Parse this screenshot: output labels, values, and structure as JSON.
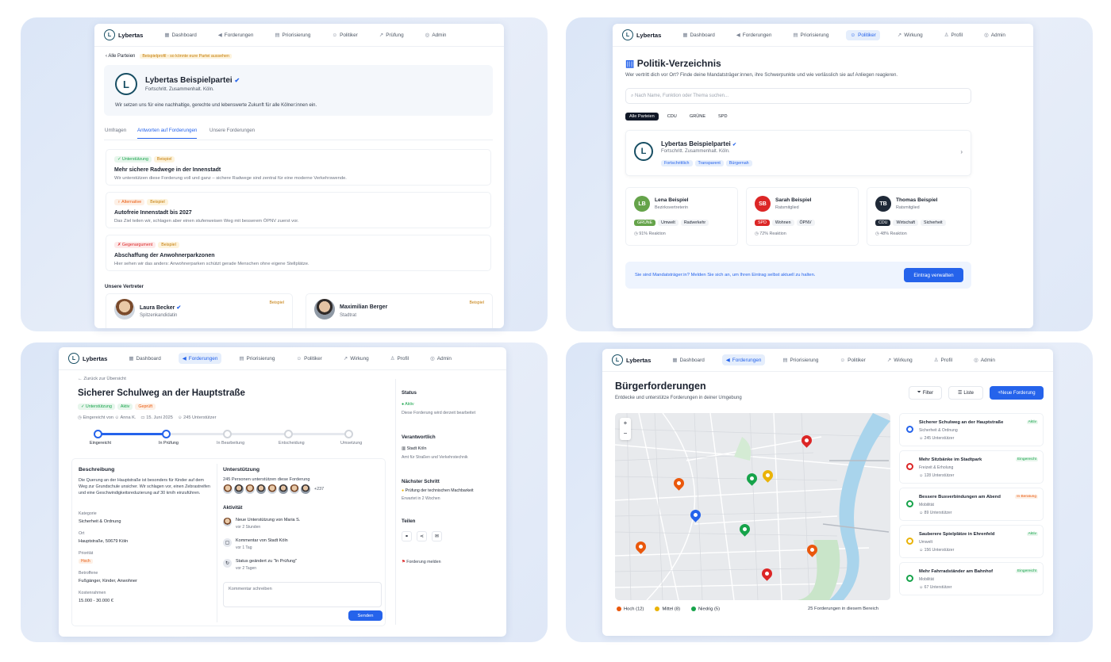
{
  "nav": {
    "logo": "Lybertas",
    "dashboard": "Dashboard",
    "forderungen": "Forderungen",
    "priorisierung": "Priorisierung",
    "politiker": "Politiker",
    "pruefung": "Prüfung",
    "admin": "Admin",
    "wirkung": "Wirkung",
    "profil": "Profil"
  },
  "party": {
    "back": "Alle Parteien",
    "banner": "Beispielprofil - so könnte eure Partei aussehen",
    "name": "Lybertas Beispielpartei",
    "slogan": "Fortschritt. Zusammenhalt. Köln.",
    "desc": "Wir setzen uns für eine nachhaltige, gerechte und lebenswerte Zukunft für alle Kölner:innen ein.",
    "tabs": [
      "Umfragen",
      "Antworten auf Forderungen",
      "Unsere Forderungen"
    ],
    "answers": [
      {
        "tag": "Unterstützung",
        "badge": "Beispiel",
        "title": "Mehr sichere Radwege in der Innenstadt",
        "text": "Wir unterstützen diese Forderung voll und ganz – sichere Radwege sind zentral für eine moderne Verkehrswende.",
        "color": "#16a34a",
        "bg": "#e7f6ec"
      },
      {
        "tag": "Alternative",
        "badge": "Beispiel",
        "title": "Autofreie Innenstadt bis 2027",
        "text": "Das Ziel teilen wir, schlagen aber einen stufenweisen Weg mit besserem ÖPNV zuerst vor.",
        "color": "#ea580c",
        "bg": "#fdf0e6"
      },
      {
        "tag": "Gegenargument",
        "badge": "Beispiel",
        "title": "Abschaffung der Anwohnerparkzonen",
        "text": "Hier sehen wir das anders: Anwohnerparken schützt gerade Menschen ohne eigene Stellplätze.",
        "color": "#dc2626",
        "bg": "#fdeaea"
      }
    ],
    "reps_title": "Unsere Vertreter",
    "reps": [
      {
        "name": "Laura Becker",
        "role": "Spitzenkandidatin",
        "badge": "Beispiel"
      },
      {
        "name": "Maximilian Berger",
        "role": "Stadtrat",
        "badge": "Beispiel"
      }
    ]
  },
  "politik": {
    "title": "Politik-Verzeichnis",
    "subtitle": "Wer vertritt dich vor Ort? Finde deine Mandatsträger:innen, ihre Schwerpunkte und wie verlässlich sie auf Anliegen reagieren.",
    "search_placeholder": "Nach Name, Funktion oder Thema suchen...",
    "filters": [
      "Alle Parteien",
      "CDU",
      "GRÜNE",
      "SPD"
    ],
    "party": {
      "name": "Lybertas Beispielpartei",
      "slogan": "Fortschritt. Zusammenhalt. Köln.",
      "tags": [
        "Fortschrittlich",
        "Transparent",
        "Bürgernah"
      ]
    },
    "people": [
      {
        "initials": "LB",
        "name": "Lena Beispiel",
        "role": "Bezirksvertreterin",
        "party": "GRÜNE",
        "tags": [
          "Umwelt",
          "Radverkehr"
        ],
        "reaction": "91% Reaktion",
        "color": "#65a34a"
      },
      {
        "initials": "SB",
        "name": "Sarah Beispiel",
        "role": "Ratsmitglied",
        "party": "SPD",
        "tags": [
          "Wohnen",
          "ÖPNV"
        ],
        "reaction": "72% Reaktion",
        "color": "#dc2626"
      },
      {
        "initials": "TB",
        "name": "Thomas Beispiel",
        "role": "Ratsmitglied",
        "party": "CDU",
        "tags": [
          "Wirtschaft",
          "Sicherheit"
        ],
        "reaction": "48% Reaktion",
        "color": "#1f2937"
      }
    ],
    "cta_text": "Sie sind Mandatsträger:in? Melden Sie sich an, um Ihren Eintrag selbst aktuell zu halten.",
    "cta_button": "Eintrag verwalten"
  },
  "detail": {
    "back": "Zurück zur Übersicht",
    "title": "Sicherer Schulweg an der Hauptstraße",
    "chips": [
      "Unterstützung",
      "Aktiv",
      "Geprüft"
    ],
    "submitted_by": "Eingereicht von",
    "author": "Anna K.",
    "date": "15. Juni 2025",
    "supporters": "245 Unterstützer",
    "steps": [
      "Eingereicht",
      "In Prüfung",
      "In Bearbeitung",
      "Entscheidung",
      "Umsetzung"
    ],
    "desc_title": "Beschreibung",
    "desc": "Die Querung an der Hauptstraße ist besonders für Kinder auf dem Weg zur Grundschule unsicher. Wir schlagen vor, einen Zebrastreifen und eine Geschwindigkeitsreduzierung auf 30 km/h einzuführen.",
    "kategorie_label": "Kategorie",
    "kategorie": "Sicherheit & Ordnung",
    "ort_label": "Ort",
    "ort": "Hauptstraße, 50679 Köln",
    "prio_label": "Priorität",
    "prio": "Hoch",
    "betroffene_label": "Betroffene",
    "betroffene": "Fußgänger, Kinder, Anwohner",
    "kosten_label": "Kostenrahmen",
    "kosten": "15.000 - 30.000 €",
    "support_title": "Unterstützung",
    "support_text": "245 Personen unterstützen diese Forderung",
    "more": "+237",
    "activity_title": "Aktivität",
    "activities": [
      {
        "text": "Neue Unterstützung von Maria S.",
        "time": "vor 2 Stunden"
      },
      {
        "text": "Kommentar von Stadt Köln",
        "time": "vor 1 Tag"
      },
      {
        "text": "Status geändert zu \"In Prüfung\"",
        "time": "vor 2 Tagen"
      }
    ],
    "comment_placeholder": "Kommentar schreiben",
    "send": "Senden",
    "status_title": "Status",
    "status": "Aktiv",
    "status_text": "Diese Forderung wird derzeit bearbeitet",
    "resp_title": "Verantwortlich",
    "resp_org": "Stadt Köln",
    "resp_dept": "Amt für Straßen und Verkehrstechnik",
    "next_title": "Nächster Schritt",
    "next": "Prüfung der technischen Machbarkeit",
    "next_eta": "Erwartet in 2 Wochen",
    "share_title": "Teilen",
    "report": "Forderung melden"
  },
  "map": {
    "title": "Bürgerforderungen",
    "subtitle": "Entdecke und unterstütze Forderungen in deiner Umgebung",
    "filter": "Filter",
    "list": "Liste",
    "new": "Neue Forderung",
    "zoom_in": "+",
    "zoom_out": "−",
    "items": [
      {
        "title": "Sicherer Schulweg an der Hauptstraße",
        "cat": "Sicherheit & Ordnung",
        "count": "245 Unterstützer",
        "status": "Aktiv",
        "color": "#2563eb",
        "scolor": "#16a34a"
      },
      {
        "title": "Mehr Sitzbänke im Stadtpark",
        "cat": "Freizeit & Erholung",
        "count": "128 Unterstützer",
        "status": "Eingereicht",
        "color": "#dc2626",
        "scolor": "#16a34a"
      },
      {
        "title": "Bessere Busverbindungen am Abend",
        "cat": "Mobilität",
        "count": "89 Unterstützer",
        "status": "In Beratung",
        "color": "#16a34a",
        "scolor": "#ea580c"
      },
      {
        "title": "Sauberere Spielplätze in Ehrenfeld",
        "cat": "Umwelt",
        "count": "156 Unterstützer",
        "status": "Aktiv",
        "color": "#eab308",
        "scolor": "#16a34a"
      },
      {
        "title": "Mehr Fahrradständer am Bahnhof",
        "cat": "Mobilität",
        "count": "67 Unterstützer",
        "status": "Eingereicht",
        "color": "#16a34a",
        "scolor": "#16a34a"
      }
    ],
    "legend": [
      {
        "label": "Hoch (12)",
        "color": "#ea580c"
      },
      {
        "label": "Mittel (8)",
        "color": "#eab308"
      },
      {
        "label": "Niedrig (5)",
        "color": "#16a34a"
      }
    ],
    "total": "25 Forderungen in diesem Bereich"
  }
}
